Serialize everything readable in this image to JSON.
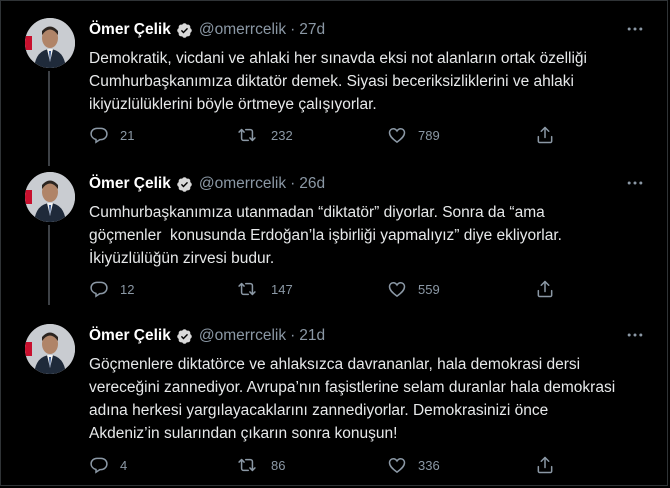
{
  "author": {
    "name": "Ömer Çelik",
    "handle": "@omerrcelik"
  },
  "colors": {
    "background": "#000000",
    "text": "#e7e9ea",
    "muted": "#8b98a5",
    "verified": "#d9d9d9",
    "thread_line": "#3d4146"
  },
  "icons": [
    "verified-badge-icon",
    "more-icon",
    "reply-icon",
    "retweet-icon",
    "like-icon",
    "share-icon"
  ],
  "tweets": [
    {
      "time": "27d",
      "text": "Demokratik, vicdani ve ahlaki her sınavda eksi not alanların ortak özelliği\nCumhurbaşkanımıza diktatör demek. Siyasi beceriksizliklerini ve ahlaki\nikiyüzlülüklerini böyle örtmeye çalışıyorlar.",
      "replies": "21",
      "retweets": "232",
      "likes": "789"
    },
    {
      "time": "26d",
      "text": "Cumhurbaşkanımıza utanmadan “diktatör” diyorlar. Sonra da “ama\ngöçmenler  konusunda Erdoğan’la işbirliği yapmalıyız” diye ekliyorlar.\nİkiyüzlülüğün zirvesi budur.",
      "replies": "12",
      "retweets": "147",
      "likes": "559"
    },
    {
      "time": "21d",
      "text": "Göçmenlere diktatörce ve ahlaksızca davrananlar, hala demokrasi dersi\nvereceğini zannediyor. Avrupa’nın faşistlerine selam duranlar hala demokrasi\nadına herkesi yargılayacaklarını zannediyorlar. Demokrasinizi önce\nAkdeniz’in sularından çıkarın sonra konuşun!",
      "replies": "4",
      "retweets": "86",
      "likes": "336"
    }
  ]
}
